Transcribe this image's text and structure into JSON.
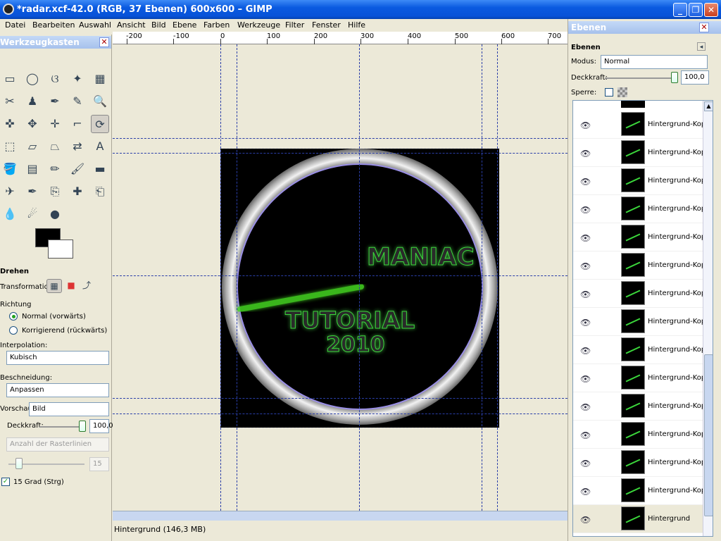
{
  "window": {
    "title": "*radar.xcf-42.0 (RGB, 37 Ebenen) 600x600 – GIMP"
  },
  "menu": [
    "Datei",
    "Bearbeiten",
    "Auswahl",
    "Ansicht",
    "Bild",
    "Ebene",
    "Farben",
    "Werkzeuge",
    "Filter",
    "Fenster",
    "Hilfe"
  ],
  "toolbox": {
    "title": "Werkzeugkasten",
    "tools": [
      "rect-select-icon",
      "ellipse-select-icon",
      "lasso-icon",
      "fuzzy-select-icon",
      "color-select-icon",
      "scissors-icon",
      "foreground-select-icon",
      "paths-icon",
      "color-picker-icon",
      "zoom-icon",
      "measure-icon",
      "move-icon",
      "align-icon",
      "crop-icon",
      "rotate-icon",
      "scale-icon",
      "shear-icon",
      "perspective-icon",
      "flip-icon",
      "text-icon",
      "bucket-fill-icon",
      "blend-icon",
      "pencil-icon",
      "paintbrush-icon",
      "eraser-icon",
      "airbrush-icon",
      "ink-icon",
      "clone-icon",
      "heal-icon",
      "perspective-clone-icon",
      "blur-icon",
      "smudge-icon",
      "dodge-burn-icon"
    ],
    "glyphs": [
      "▭",
      "◯",
      "ଓ",
      "✦",
      "▦",
      "✂",
      "♟",
      "✒",
      "✎",
      "🔍",
      "✜",
      "✥",
      "✛",
      "⌐",
      "⟳",
      "⬚",
      "▱",
      "⏢",
      "⇄",
      "A",
      "🪣",
      "▤",
      "✏",
      "🖌",
      "▬",
      "✈",
      "✒",
      "⎘",
      "✚",
      "⎗",
      "💧",
      "☄",
      "●"
    ],
    "options": {
      "title": "Drehen",
      "transform_label": "Transformation:",
      "direction_label": "Richtung",
      "dir_normal": "Normal (vorwärts)",
      "dir_corrective": "Korrigierend (rückwärts)",
      "interp_label": "Interpolation:",
      "interp_value": "Kubisch",
      "clip_label": "Beschneidung:",
      "clip_value": "Anpassen",
      "preview_label": "Vorschau:",
      "preview_value": "Bild",
      "opacity_label": "Deckkraft:",
      "opacity_value": "100,0",
      "grid_placeholder": "Anzahl der Rasterlinien",
      "grid_value": "15",
      "snap_label": "15 Grad (Strg)"
    }
  },
  "canvas": {
    "ruler_labels": [
      "-200",
      "-100",
      "0",
      "100",
      "200",
      "300",
      "400",
      "500",
      "600",
      "700"
    ],
    "image_text_1": "MANIAC",
    "image_text_2": "TUTORIAL",
    "image_text_3": "2010",
    "status": "Hintergrund (146,3 MB)"
  },
  "layers_panel": {
    "dock_title": "Ebenen",
    "title": "Ebenen",
    "mode_label": "Modus:",
    "mode_value": "Normal",
    "opacity_label": "Deckkraft:",
    "opacity_value": "100,0",
    "lock_label": "Sperre:",
    "layers": [
      "Hintergrund-Kopi",
      "Hintergrund-Kopi",
      "Hintergrund-Kopi",
      "Hintergrund-Kopi",
      "Hintergrund-Kopi",
      "Hintergrund-Kopi",
      "Hintergrund-Kopi",
      "Hintergrund-Kopi",
      "Hintergrund-Kopi",
      "Hintergrund-Kopi",
      "Hintergrund-Kopi",
      "Hintergrund-Kopi",
      "Hintergrund-Kopi",
      "Hintergrund-Kopi",
      "Hintergrund"
    ]
  },
  "colors": {
    "accent": "#0a5ae0",
    "glow": "#3bd63b",
    "guide": "#2a3ea8"
  }
}
